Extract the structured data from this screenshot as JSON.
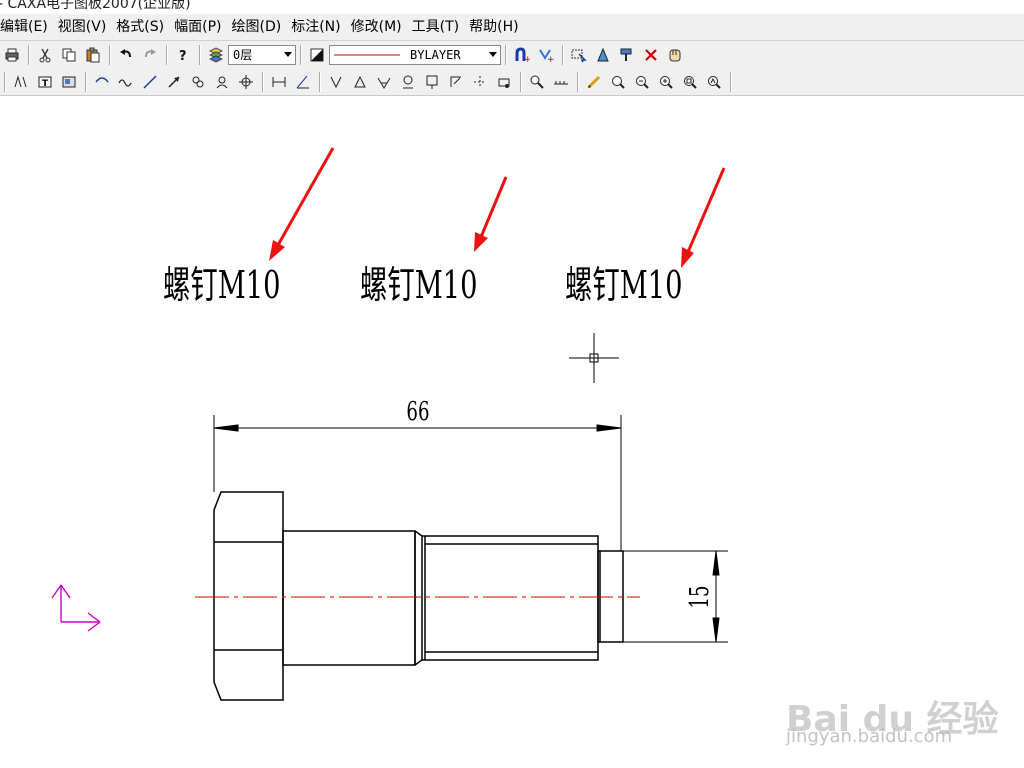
{
  "window": {
    "title": "- CAXA电子图板2007(企业版)"
  },
  "menu": {
    "items": [
      "编辑(E)",
      "视图(V)",
      "格式(S)",
      "幅面(P)",
      "绘图(D)",
      "标注(N)",
      "修改(M)",
      "工具(T)",
      "帮助(H)"
    ]
  },
  "toolbar": {
    "layer_value": "0层",
    "linetype_value": "BYLAYER",
    "colors": {
      "linetype_sample": "#e00000"
    }
  },
  "drawing": {
    "labels": [
      "螺钉M10",
      "螺钉M10",
      "螺钉M10"
    ],
    "dimension_length": "66",
    "dimension_diameter": "15",
    "colors": {
      "geometry": "#000000",
      "centerline": "#d00000",
      "annotation_arrow": "#ee1111",
      "ucs_icon": "#cc00cc"
    }
  },
  "watermark": {
    "brand": "Bai du 经验",
    "url": "jingyan.baidu.com"
  }
}
